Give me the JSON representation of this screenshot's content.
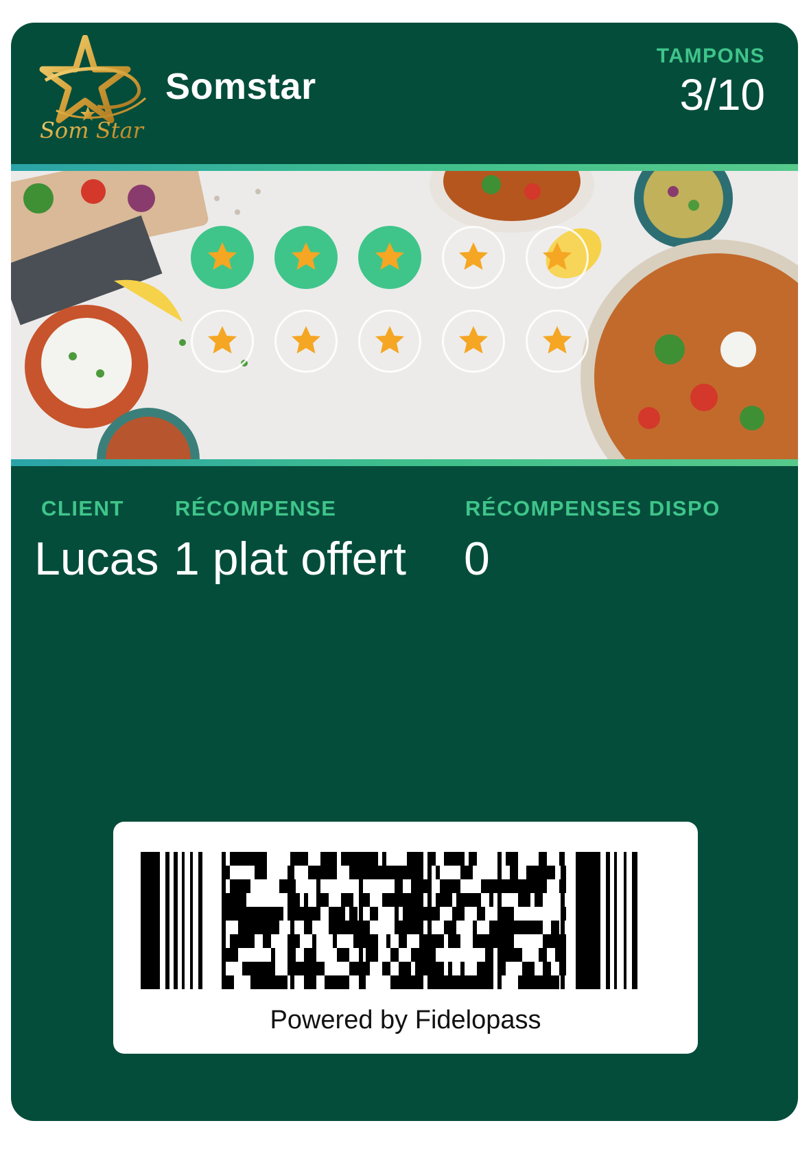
{
  "header": {
    "brand_name": "Somstar",
    "logo_text": "Som Star",
    "stamps_label": "TAMPONS",
    "stamps_value": "3/10"
  },
  "stamps": {
    "total": 10,
    "filled": 3,
    "icon": "star-icon",
    "filled_color": "#3fc58a",
    "star_color": "#f5a623"
  },
  "fields": {
    "client_label": "CLIENT",
    "client_value": "Lucas",
    "reward_label": "RÉCOMPENSE",
    "reward_value": "1 plat offert",
    "available_label": "RÉCOMPENSES DISPO",
    "available_value": "0"
  },
  "barcode": {
    "type": "PDF417",
    "footer": "Powered by Fidelopass"
  },
  "colors": {
    "card_bg": "#054d3b",
    "accent": "#3fc58a",
    "text": "#ffffff"
  }
}
